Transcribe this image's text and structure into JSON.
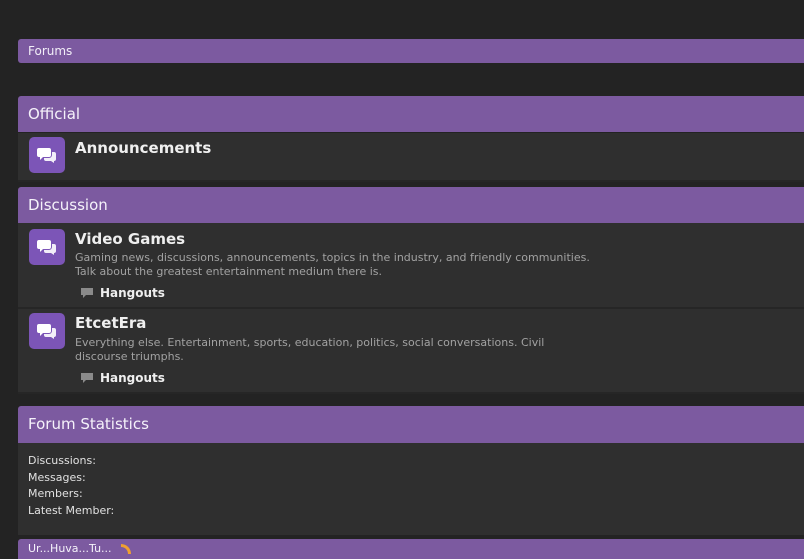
{
  "breadcrumb": {
    "label": "Forums"
  },
  "categories": [
    {
      "title": "Official",
      "forums": [
        {
          "title": "Announcements",
          "description": "",
          "subforum": ""
        }
      ]
    },
    {
      "title": "Discussion",
      "forums": [
        {
          "title": "Video Games",
          "description": "Gaming news, discussions, announcements, topics in the industry, and friendly communities. Talk about the greatest entertainment medium there is.",
          "subforum": "Hangouts"
        },
        {
          "title": "EtcetEra",
          "description": "Everything else. Entertainment, sports, education, politics, social conversations. Civil discourse triumphs.",
          "subforum": "Hangouts"
        }
      ]
    }
  ],
  "statistics": {
    "title": "Forum Statistics",
    "discussions_label": "Discussions:",
    "messages_label": "Messages:",
    "members_label": "Members:",
    "latest_member_label": "Latest Member:"
  },
  "footer_bar": {
    "label": "Ur...Huva...Tu..."
  },
  "colors": {
    "accent": "#7c5aa0",
    "icon_bg": "#7c55b7",
    "row_bg": "#2f2f2f",
    "page_bg": "#232323"
  }
}
